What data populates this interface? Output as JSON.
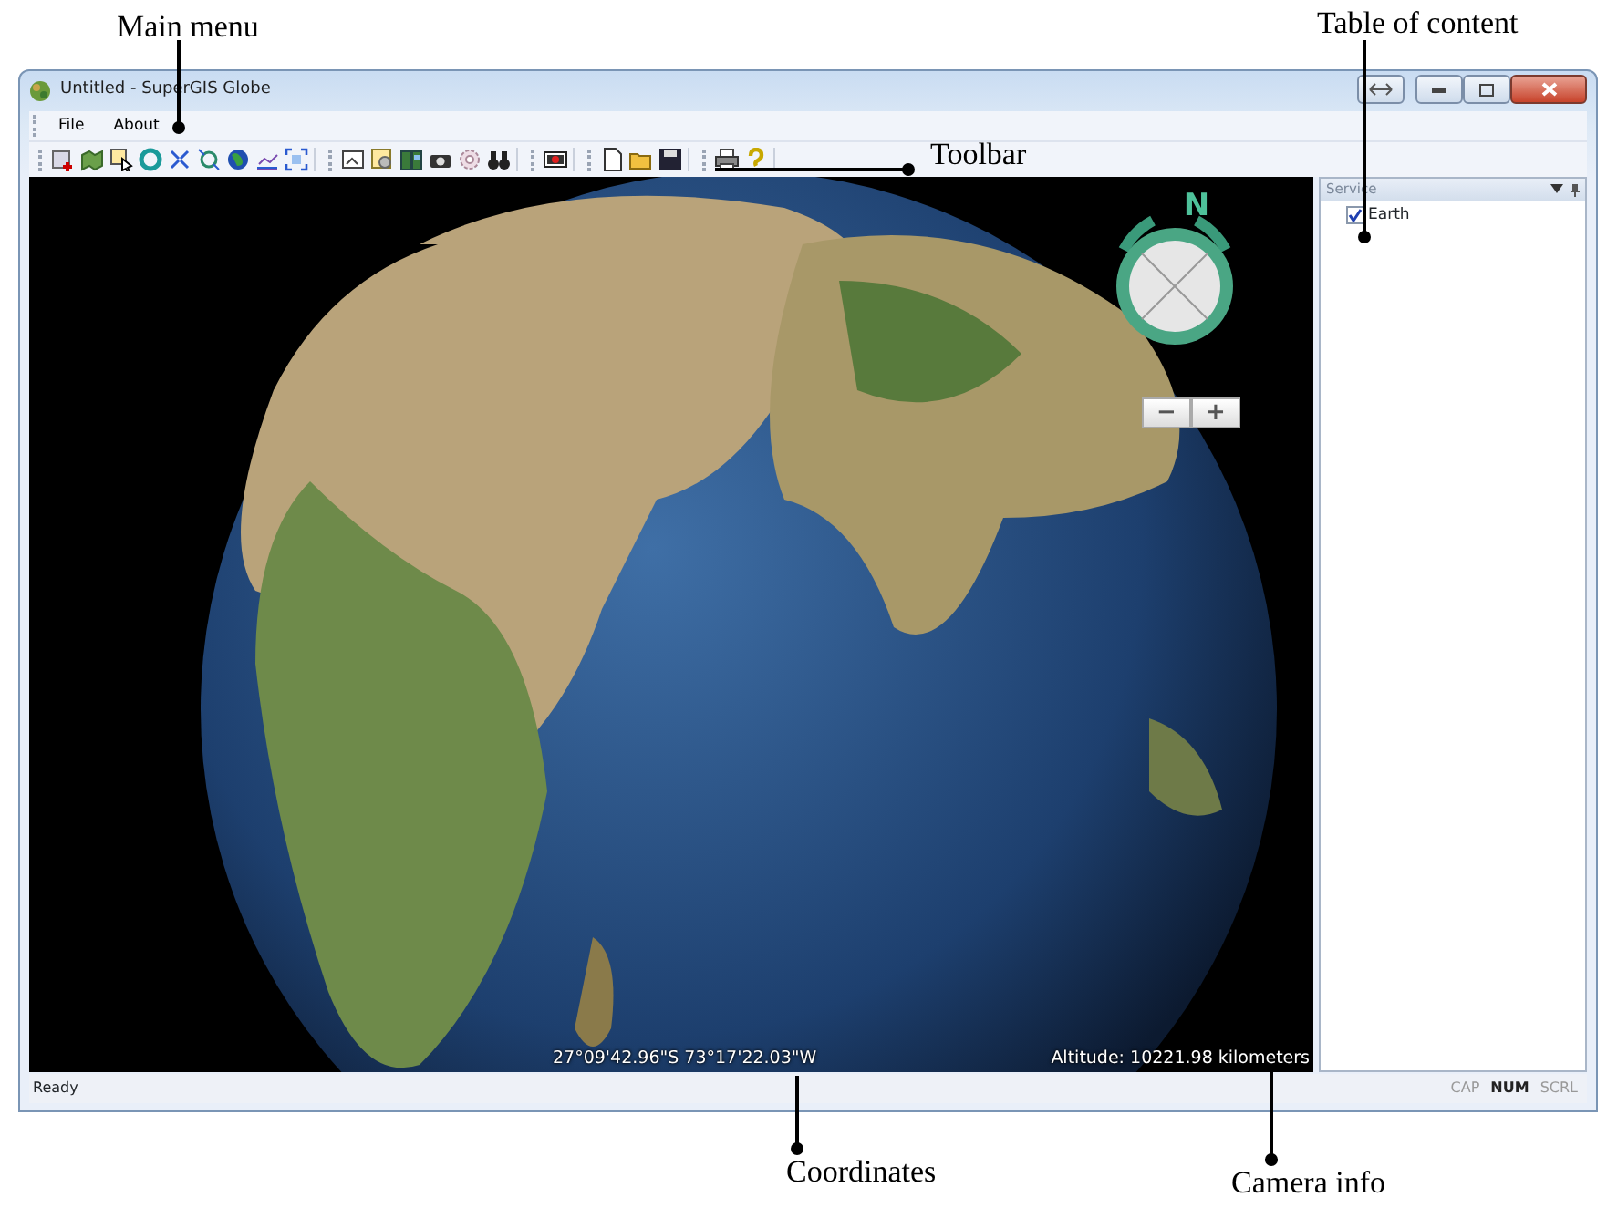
{
  "callouts": [
    {
      "text": "Main menu"
    },
    {
      "text": "Table of content"
    },
    {
      "text": "Toolbar"
    },
    {
      "text": "Coordinates"
    },
    {
      "text": "Camera info"
    }
  ],
  "window": {
    "title": "Untitled - SuperGIS Globe"
  },
  "menu": [
    "File",
    "About"
  ],
  "viewport": {
    "compass_label": "N",
    "zoom_buttons": [
      "−",
      "+"
    ],
    "coordinates": "27°09'42.96\"S 73°17'22.03\"W",
    "altitude": "Altitude: 10221.98 kilometers"
  },
  "toc": {
    "title": "Service",
    "items": [
      {
        "label": "Earth",
        "checked": true
      }
    ]
  },
  "status_bar": {
    "text": "Ready",
    "indicators": [
      {
        "label": "CAP",
        "on": false
      },
      {
        "label": "NUM",
        "on": true
      },
      {
        "label": "SCRL",
        "on": false
      }
    ]
  }
}
